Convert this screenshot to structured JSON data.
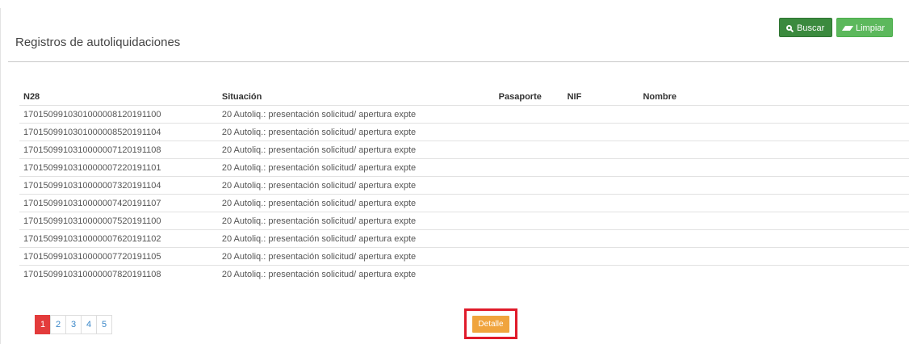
{
  "panel": {
    "title": "Registros de autoliquidaciones"
  },
  "toolbar": {
    "buscar_label": "Buscar",
    "limpiar_label": "Limpiar"
  },
  "table": {
    "columns": [
      "N28",
      "Situación",
      "Pasaporte",
      "NIF",
      "Nombre"
    ],
    "rows": [
      {
        "n28": "170150991030100000812019110​0",
        "situacion": "20 Autoliq.: presentación solicitud/ apertura expte",
        "pasaporte": "",
        "nif": "",
        "nombre": ""
      },
      {
        "n28": "17015099103010000085201911​04",
        "situacion": "20 Autoliq.: presentación solicitud/ apertura expte",
        "pasaporte": "",
        "nif": "",
        "nombre": ""
      },
      {
        "n28": "17015099103100000071201911​08",
        "situacion": "20 Autoliq.: presentación solicitud/ apertura expte",
        "pasaporte": "",
        "nif": "",
        "nombre": ""
      },
      {
        "n28": "17015099103100000072201911​01",
        "situacion": "20 Autoliq.: presentación solicitud/ apertura expte",
        "pasaporte": "",
        "nif": "",
        "nombre": ""
      },
      {
        "n28": "17015099103100000073201911​04",
        "situacion": "20 Autoliq.: presentación solicitud/ apertura expte",
        "pasaporte": "",
        "nif": "",
        "nombre": ""
      },
      {
        "n28": "17015099103100000074201911​07",
        "situacion": "20 Autoliq.: presentación solicitud/ apertura expte",
        "pasaporte": "",
        "nif": "",
        "nombre": ""
      },
      {
        "n28": "17015099103100000075201911​00",
        "situacion": "20 Autoliq.: presentación solicitud/ apertura expte",
        "pasaporte": "",
        "nif": "",
        "nombre": ""
      },
      {
        "n28": "17015099103100000076201911​02",
        "situacion": "20 Autoliq.: presentación solicitud/ apertura expte",
        "pasaporte": "",
        "nif": "",
        "nombre": ""
      },
      {
        "n28": "17015099103100000077201911​05",
        "situacion": "20 Autoliq.: presentación solicitud/ apertura expte",
        "pasaporte": "",
        "nif": "",
        "nombre": ""
      },
      {
        "n28": "17015099103100000078201911​08",
        "situacion": "20 Autoliq.: presentación solicitud/ apertura expte",
        "pasaporte": "",
        "nif": "",
        "nombre": ""
      }
    ]
  },
  "pagination": {
    "pages": [
      "1",
      "2",
      "3",
      "4",
      "5"
    ],
    "active": "1"
  },
  "detalle_label": "Detalle",
  "colors": {
    "buscar": "#3b8a3e",
    "limpiar": "#5cb85c",
    "active_page": "#e33b3b",
    "detalle": "#f0a43d",
    "highlight": "#e01a2a"
  },
  "icons": {
    "buscar": "search-icon",
    "limpiar": "eraser-icon"
  }
}
